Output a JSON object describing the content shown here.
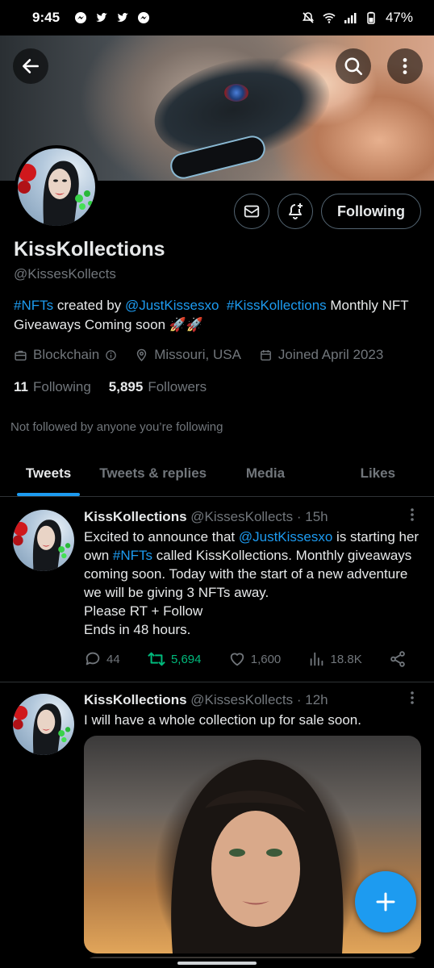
{
  "status_bar": {
    "time": "9:45",
    "battery": "47%"
  },
  "profile": {
    "name": "KissKollections",
    "handle": "@KissesKollects",
    "bio": {
      "tag1": "#NFTs",
      "created_by": " created by ",
      "mention": "@JustKissesxo",
      "tag2": "#KissKollections",
      "rest": " Monthly NFT Giveaways Coming soon 🚀🚀"
    },
    "category": "Blockchain",
    "location": "Missouri, USA",
    "joined": "Joined April 2023",
    "following_count": "11",
    "following_label": "Following",
    "followers_count": "5,895",
    "followers_label": "Followers",
    "not_followed": "Not followed by anyone you’re following",
    "follow_button": "Following"
  },
  "tabs": [
    {
      "label": "Tweets",
      "active": true
    },
    {
      "label": "Tweets & replies",
      "active": false
    },
    {
      "label": "Media",
      "active": false
    },
    {
      "label": "Likes",
      "active": false
    }
  ],
  "tweets": [
    {
      "name": "KissKollections",
      "handle": "@KissesKollects",
      "time": "· 15h",
      "text_a": "Excited to announce that ",
      "mention": "@JustKissesxo",
      "text_b": " is starting her own ",
      "tag": "#NFTs",
      "text_c": " called KissKollections. Monthly giveaways coming soon. Today with the start of a new adventure we will be giving 3 NFTs away.",
      "line2": "Please RT + Follow",
      "line3": "Ends in 48 hours.",
      "replies": "44",
      "retweets": "5,694",
      "likes": "1,600",
      "views": "18.8K"
    },
    {
      "name": "KissKollections",
      "handle": "@KissesKollects",
      "time": "· 12h",
      "text": "I will have a whole collection up for sale soon."
    }
  ],
  "colors": {
    "accent": "#1d9bf0",
    "retweet": "#00ba7c",
    "muted": "#71767b",
    "background": "#000000"
  },
  "icons": [
    "back-arrow-icon",
    "search-icon",
    "more-vertical-icon",
    "mail-icon",
    "bell-plus-icon",
    "briefcase-icon",
    "info-icon",
    "location-pin-icon",
    "calendar-icon",
    "reply-icon",
    "retweet-icon",
    "heart-icon",
    "views-icon",
    "share-icon",
    "compose-plus-icon"
  ]
}
